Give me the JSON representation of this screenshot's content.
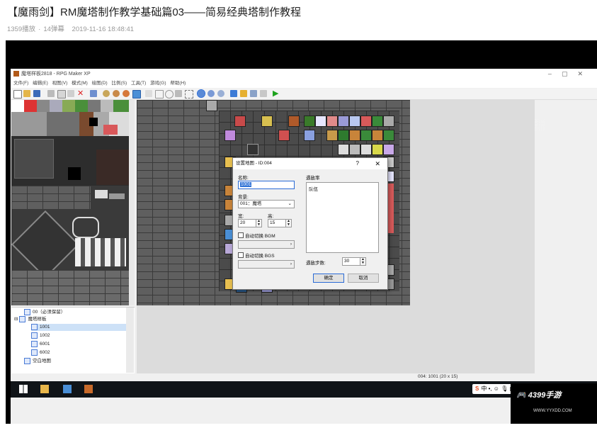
{
  "video": {
    "title": "【魔雨剑】RM魔塔制作教学基础篇03——简易经典塔制作教程",
    "plays": "1359播放",
    "danmaku": "14弹幕",
    "datetime": "2019-11-16 18:48:41"
  },
  "app": {
    "window_title": "魔塔样板2818 - RPG Maker XP",
    "menu": [
      "文件(F)",
      "编辑(E)",
      "视图(V)",
      "模式(M)",
      "绘图(D)",
      "比例(S)",
      "工具(T)",
      "游戏(G)",
      "帮助(H)"
    ],
    "window_controls": [
      "–",
      "▢",
      "✕"
    ]
  },
  "tree": {
    "items": [
      "00（必须保留）",
      "魔塔样板",
      "1001",
      "1002",
      "6001",
      "6002",
      "空白地图"
    ]
  },
  "status": {
    "map_info": "004: 1001 (20 x 15)"
  },
  "dialog": {
    "title": "设置地图 - ID:004",
    "help": "?",
    "close": "✕",
    "name_label": "名称:",
    "name_value": "1001",
    "bg_label": "背景:",
    "bg_value": "001：魔塔",
    "width_label": "宽:",
    "height_label": "高:",
    "width_value": "20",
    "height_value": "15",
    "auto_bgm": "自动切换 BGM",
    "auto_bgs": "自动切换 BGS",
    "encounter_label": "遇敌率",
    "encounter_item": "队伍",
    "steps_label": "遇敌步数:",
    "steps_value": "30",
    "ok": "确定",
    "cancel": "取消"
  },
  "ime": {
    "text": "中 •, ☺ 🎙 ▤ ♟ 👕 ▦"
  },
  "watermark": {
    "logo": "4399手游",
    "url": "WWW.YYXDD.COM"
  },
  "colors": {
    "title_text": "#222222",
    "meta_text": "#999999",
    "selection": "#3173d6",
    "taskbar": "#101418",
    "ime_logo": "#e8491d"
  }
}
